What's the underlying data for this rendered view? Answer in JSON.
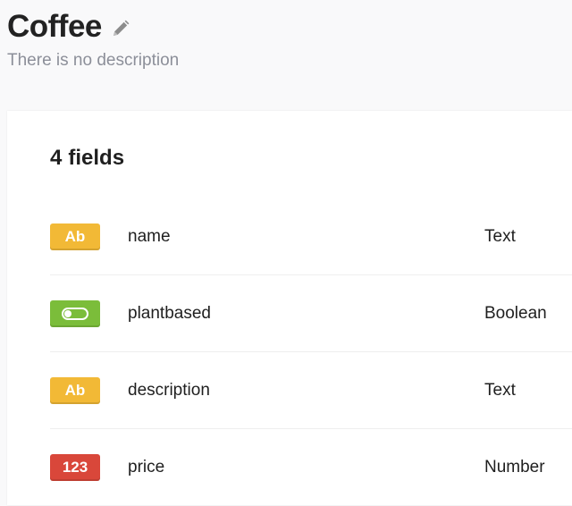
{
  "header": {
    "title": "Coffee",
    "description": "There is no description",
    "edit_icon": "pencil-icon"
  },
  "fields_card": {
    "count": "4",
    "count_label": "fields",
    "fields": [
      {
        "badge": "Ab",
        "icon": "text-type-icon",
        "name": "name",
        "type": "Text",
        "color": "#f2b936"
      },
      {
        "badge": "",
        "icon": "toggle-icon",
        "name": "plantbased",
        "type": "Boolean",
        "color": "#7bbd3a"
      },
      {
        "badge": "Ab",
        "icon": "text-type-icon",
        "name": "description",
        "type": "Text",
        "color": "#f2b936"
      },
      {
        "badge": "123",
        "icon": "number-type-icon",
        "name": "price",
        "type": "Number",
        "color": "#d9473a"
      }
    ]
  }
}
